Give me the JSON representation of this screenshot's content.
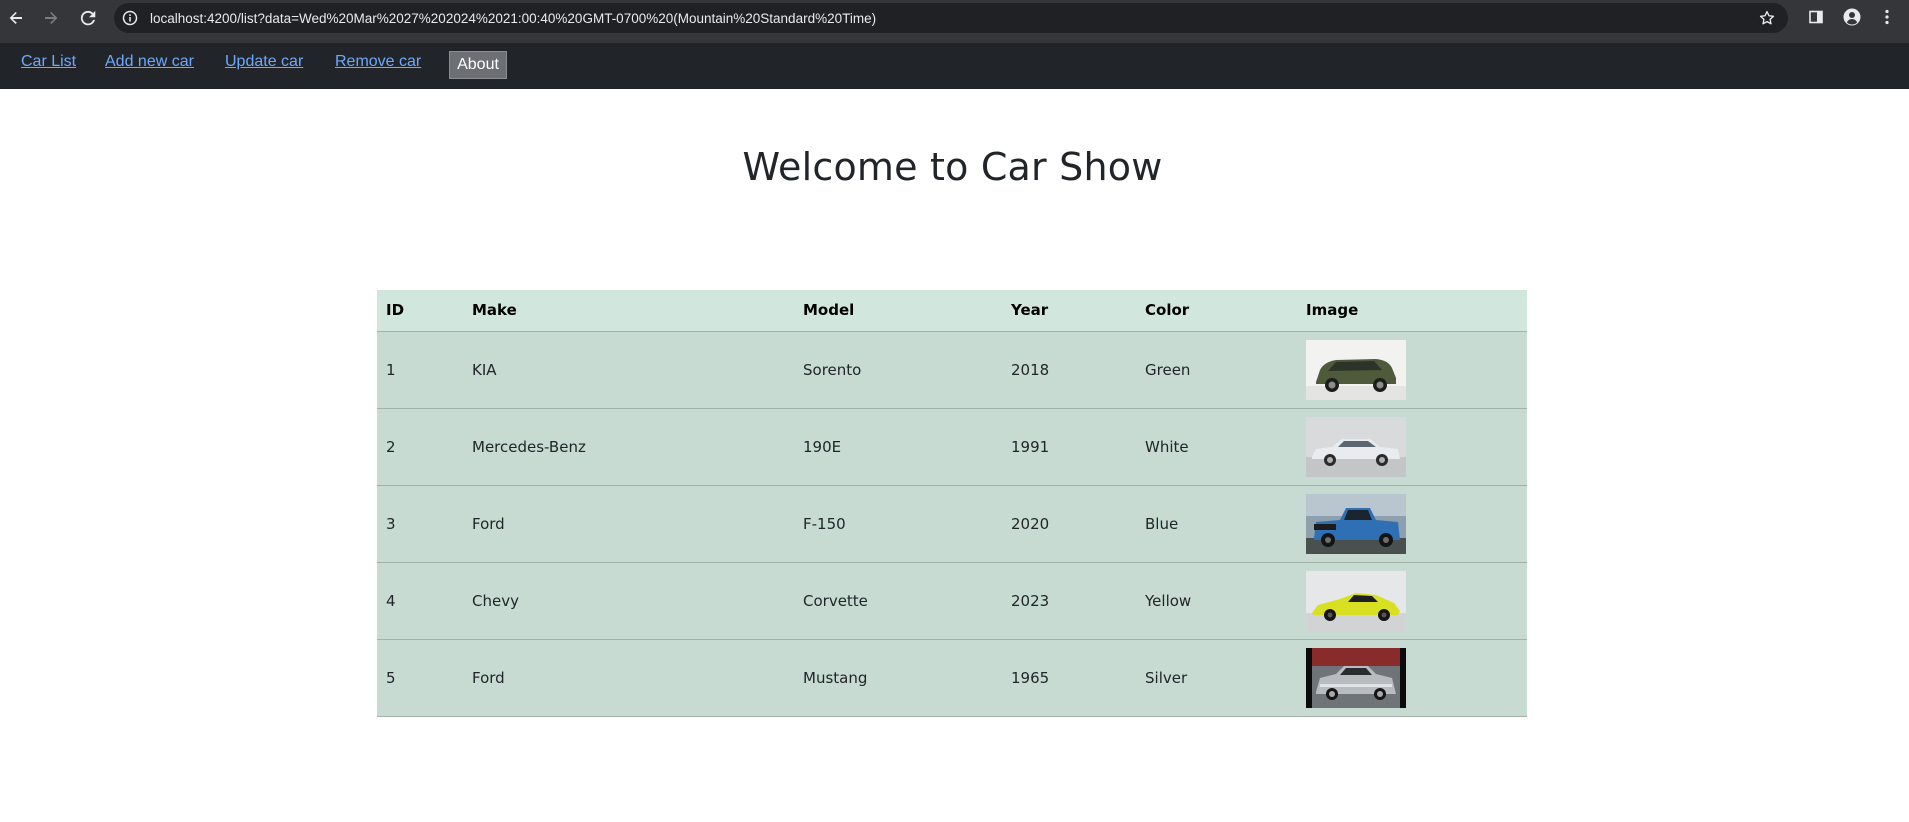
{
  "browser": {
    "url": "localhost:4200/list?data=Wed%20Mar%2027%202024%2021:00:40%20GMT-0700%20(Mountain%20Standard%20Time)",
    "icons": [
      "back-icon",
      "forward-icon",
      "reload-icon",
      "site-info-icon",
      "bookmark-star-icon",
      "side-panel-icon",
      "profile-icon",
      "menu-kebab-icon"
    ]
  },
  "nav": {
    "links": [
      "Car List",
      "Add new car",
      "Update car",
      "Remove car"
    ],
    "about_label": "About",
    "link_color": "#6ea8fe",
    "background": "#212529"
  },
  "page": {
    "title": "Welcome to Car Show"
  },
  "table": {
    "headers": [
      "ID",
      "Make",
      "Model",
      "Year",
      "Color",
      "Image"
    ],
    "header_bg": "#d1e7dd",
    "row_bg": "#c7dbd2",
    "rows": [
      {
        "id": "1",
        "make": "KIA",
        "model": "Sorento",
        "year": "2018",
        "color": "Green",
        "image": "green-suv-photo"
      },
      {
        "id": "2",
        "make": "Mercedes-Benz",
        "model": "190E",
        "year": "1991",
        "color": "White",
        "image": "white-sedan-photo"
      },
      {
        "id": "3",
        "make": "Ford",
        "model": "F-150",
        "year": "2020",
        "color": "Blue",
        "image": "blue-pickup-photo"
      },
      {
        "id": "4",
        "make": "Chevy",
        "model": "Corvette",
        "year": "2023",
        "color": "Yellow",
        "image": "yellow-sports-car-photo"
      },
      {
        "id": "5",
        "make": "Ford",
        "model": "Mustang",
        "year": "1965",
        "color": "Silver",
        "image": "silver-classic-car-photo"
      }
    ]
  }
}
